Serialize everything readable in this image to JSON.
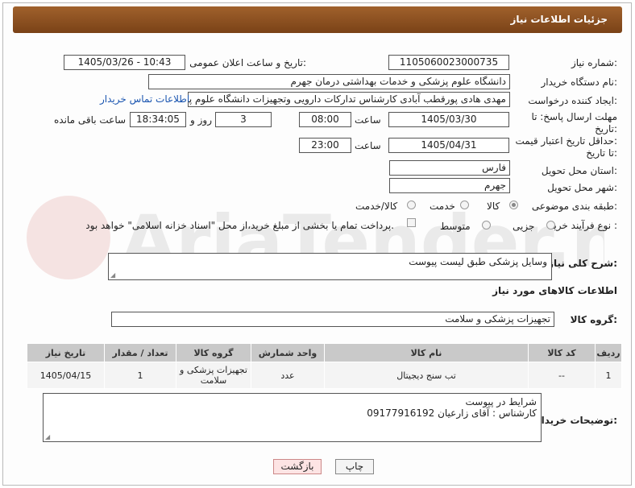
{
  "header": {
    "title": "جزئیات اطلاعات نیاز"
  },
  "fields": {
    "need_number": {
      "label": "شماره نیاز:",
      "value": "1105060023000735"
    },
    "announce_dt": {
      "label": "تاریخ و ساعت اعلان عمومی:",
      "value": "1405/03/26 - 10:43"
    },
    "buyer_org": {
      "label": "نام دستگاه خریدار:",
      "value": "دانشگاه علوم پزشکی و خدمات بهداشتی  درمان جهرم"
    },
    "creator": {
      "label": "ایجاد کننده درخواست:",
      "value": "مهدی هادی پورقطب آبادی کارشناس تدارکات دارویی وتجهیزات دانشگاه علوم پز",
      "link": "اطلاعات تماس خریدار"
    },
    "reply_deadline": {
      "label_line1": "مهلت ارسال پاسخ: تا",
      "label_line2": "تاریخ:",
      "date": "1405/03/30",
      "time_label": "ساعت",
      "time": "08:00",
      "days": "3",
      "days_label": "روز و",
      "remaining": "18:34:05",
      "remaining_label": "ساعت باقی مانده"
    },
    "price_deadline": {
      "label_line1": "حداقل تاریخ اعتبار قیمت:",
      "label_line2": "تا تاریخ:",
      "date": "1405/04/31",
      "time_label": "ساعت",
      "time": "23:00"
    },
    "province": {
      "label": "استان محل تحویل:",
      "value": "فارس"
    },
    "city": {
      "label": "شهر محل تحویل:",
      "value": "جهرم"
    },
    "category": {
      "label": "طبقه بندی موضوعی:",
      "options": [
        "کالا",
        "خدمت",
        "کالا/خدمت"
      ]
    },
    "process": {
      "label": "نوع فرآیند خرید :",
      "options": [
        "جزیی",
        "متوسط"
      ],
      "payment_note": "پرداخت تمام یا بخشی از مبلغ خرید،از محل \"اسناد خزانه اسلامی\" خواهد بود."
    }
  },
  "description": {
    "label": "شرح کلی نیاز:",
    "value": "وسایل پزشکی طبق لیست پیوست"
  },
  "goods_section": {
    "title": "اطلاعات کالاهای مورد نیاز"
  },
  "goods_group": {
    "label": "گروه کالا:",
    "value": "تجهیزات پزشکی و سلامت"
  },
  "table": {
    "headers": [
      "ردیف",
      "کد کالا",
      "نام کالا",
      "واحد شمارش",
      "گروه کالا",
      "تعداد / مقدار",
      "تاریخ نیاز"
    ],
    "rows": [
      [
        "1",
        "--",
        "تب سنج دیجیتال",
        "عدد",
        "تجهیزات پزشکی و سلامت",
        "1",
        "1405/04/15"
      ]
    ]
  },
  "buyer_notes": {
    "label": "توضیحات خریدار:",
    "line1": "شرایط در پیوست",
    "line2": "کارشناس : آقای زارعیان 09177916192"
  },
  "buttons": {
    "print": "چاپ",
    "back": "بازگشت"
  },
  "watermark": {
    "text": "AriaTender.neT",
    "color": "#c0392b"
  }
}
